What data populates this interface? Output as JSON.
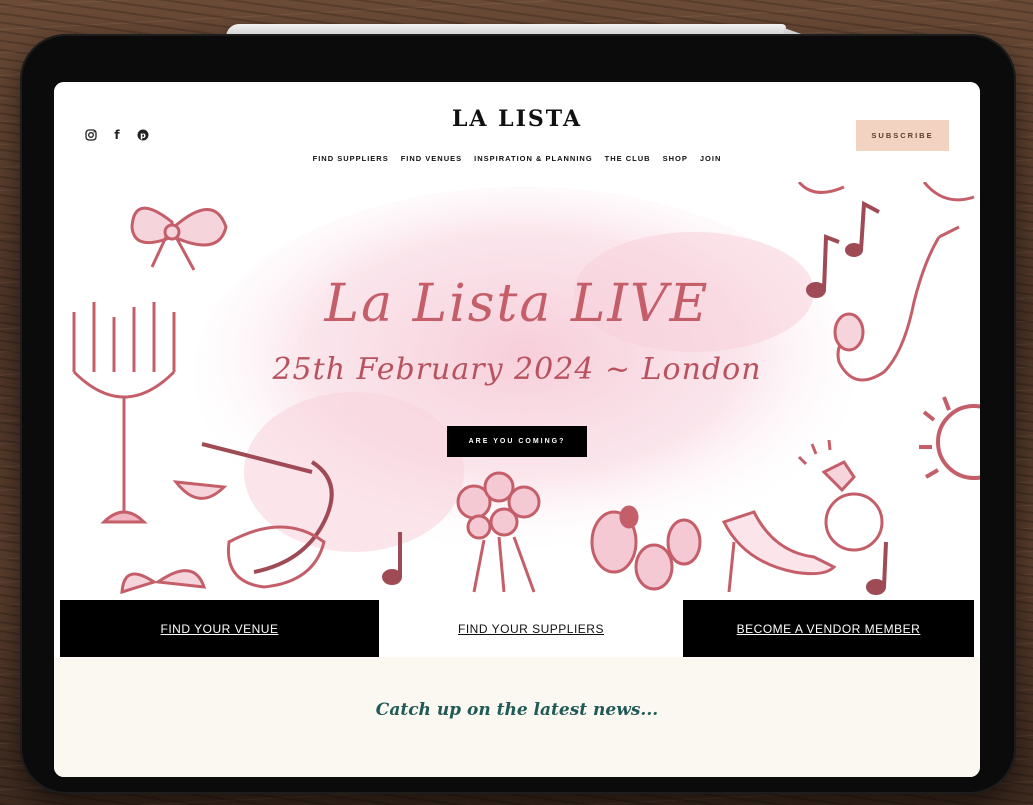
{
  "header": {
    "logo": "LA LISTA",
    "social_icons": [
      "instagram-icon",
      "facebook-icon",
      "pinterest-icon"
    ],
    "nav": [
      "FIND SUPPLIERS",
      "FIND VENUES",
      "INSPIRATION & PLANNING",
      "THE CLUB",
      "SHOP",
      "JOIN"
    ],
    "subscribe_label": "SUBSCRIBE"
  },
  "hero": {
    "title": "La Lista LIVE",
    "date": "25th February 2024 ~ London",
    "cta_label": "ARE YOU COMING?"
  },
  "bar": {
    "venue_label": "FIND YOUR VENUE",
    "suppliers_label": "FIND YOUR SUPPLIERS",
    "vendor_label": "BECOME A VENDOR MEMBER"
  },
  "news": {
    "heading": "Catch up on the latest news..."
  },
  "colors": {
    "accent_pink": "#c45f6a",
    "subscribe_bg": "#f2d3c1",
    "news_text": "#1f5a56",
    "news_bg": "#fbf7f1"
  }
}
